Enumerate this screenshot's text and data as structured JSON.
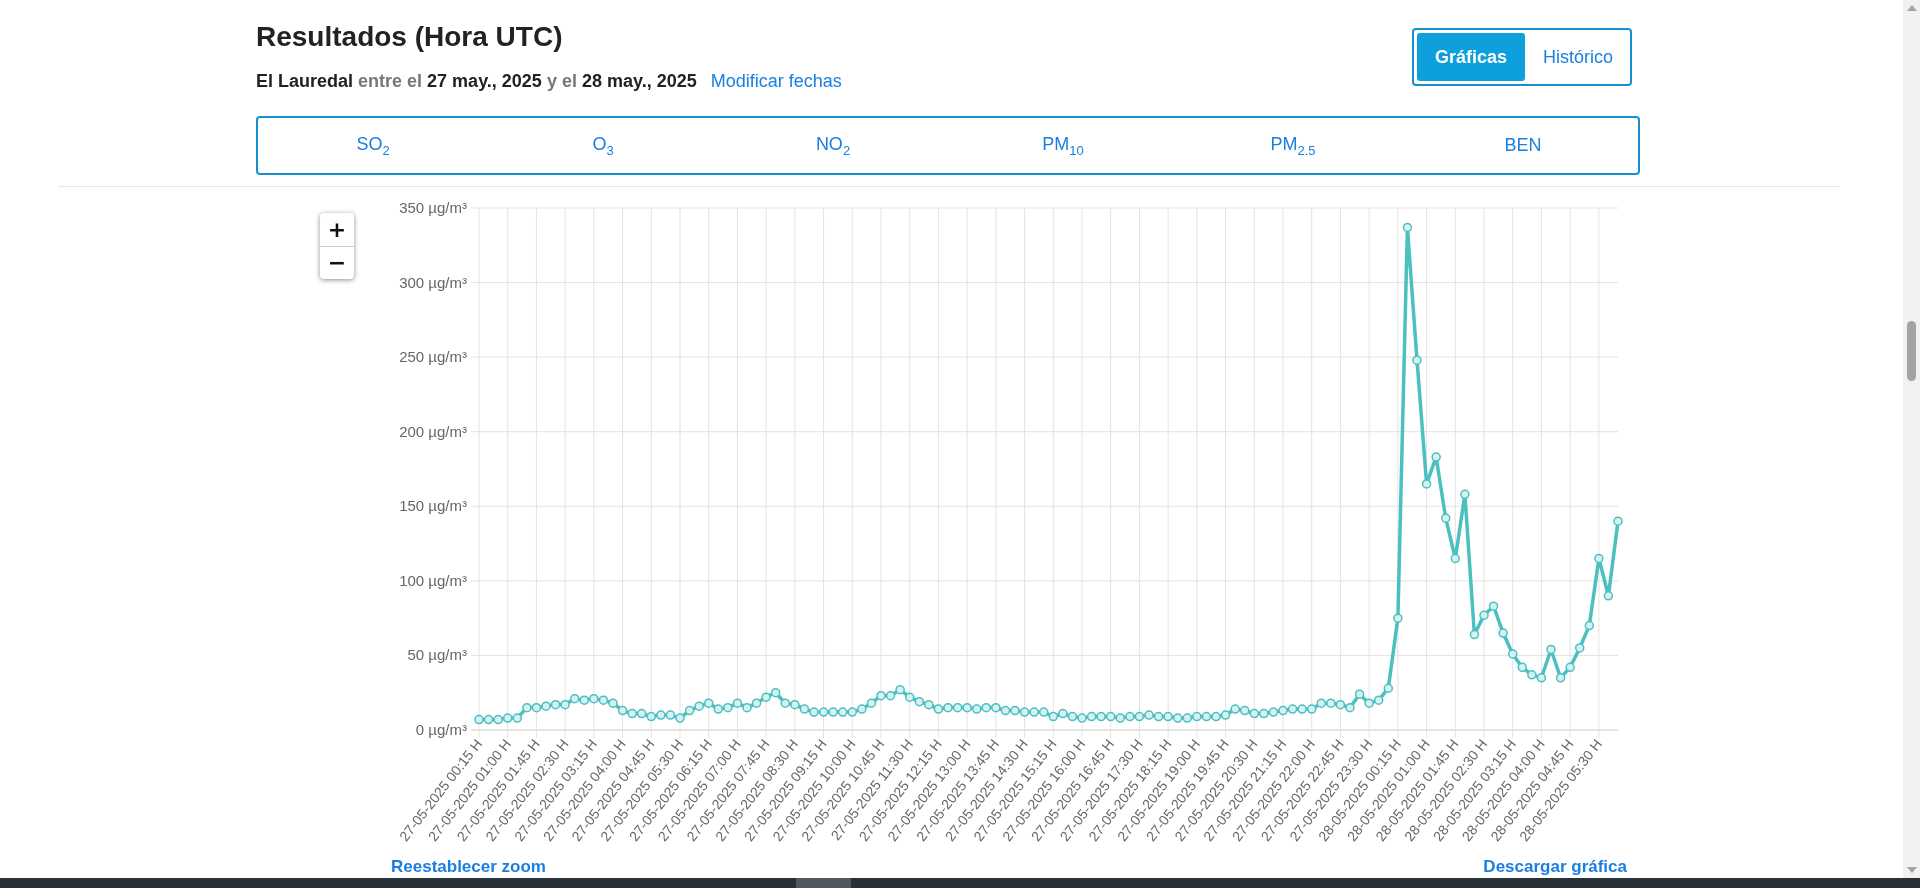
{
  "header": {
    "title": "Resultados (Hora UTC)",
    "subtitle": {
      "station": "El Lauredal",
      "from_word": "entre el",
      "from_date": "27 may., 2025",
      "to_word": "y el",
      "to_date": "28 may., 2025"
    },
    "modify_link": "Modificar fechas",
    "view_toggle": [
      {
        "label": "Gráficas",
        "selected": true
      },
      {
        "label": "Histórico",
        "selected": false
      }
    ],
    "pollutant_tabs": [
      {
        "label": "SO$_{2}$",
        "selected": false
      },
      {
        "label": "O$_{3}$",
        "selected": false
      },
      {
        "label": "NO$_{2}$",
        "selected": false
      },
      {
        "label": "PM$_{10}$",
        "selected": false
      },
      {
        "label": "PM$_{2.5}$",
        "selected": false
      },
      {
        "label": "BEN",
        "selected": false
      }
    ]
  },
  "chart": {
    "zoom_controls": [
      "+",
      "−"
    ],
    "chart_data": {
      "type": "line",
      "grid": true,
      "ylim": [
        0,
        350
      ],
      "yticks": [
        {
          "value": 0,
          "label": "0 µg/m³"
        },
        {
          "value": 50,
          "label": "50 µg/m³"
        },
        {
          "value": 100,
          "label": "100 µg/m³"
        },
        {
          "value": 150,
          "label": "150 µg/m³"
        },
        {
          "value": 200,
          "label": "200 µg/m³"
        },
        {
          "value": 250,
          "label": "250 µg/m³"
        },
        {
          "value": 300,
          "label": "300 µg/m³"
        },
        {
          "value": 350,
          "label": "350 µg/m³"
        }
      ],
      "categories": [
        "27-05-2025 00:15 H",
        null,
        null,
        "27-05-2025 01:00 H",
        null,
        null,
        "27-05-2025 01:45 H",
        null,
        null,
        "27-05-2025 02:30 H",
        null,
        null,
        "27-05-2025 03:15 H",
        null,
        null,
        "27-05-2025 04:00 H",
        null,
        null,
        "27-05-2025 04:45 H",
        null,
        null,
        "27-05-2025 05:30 H",
        null,
        null,
        "27-05-2025 06:15 H",
        null,
        null,
        "27-05-2025 07:00 H",
        null,
        null,
        "27-05-2025 07:45 H",
        null,
        null,
        "27-05-2025 08:30 H",
        null,
        null,
        "27-05-2025 09:15 H",
        null,
        null,
        "27-05-2025 10:00 H",
        null,
        null,
        "27-05-2025 10:45 H",
        null,
        null,
        "27-05-2025 11:30 H",
        null,
        null,
        "27-05-2025 12:15 H",
        null,
        null,
        "27-05-2025 13:00 H",
        null,
        null,
        "27-05-2025 13:45 H",
        null,
        null,
        "27-05-2025 14:30 H",
        null,
        null,
        "27-05-2025 15:15 H",
        null,
        null,
        "27-05-2025 16:00 H",
        null,
        null,
        "27-05-2025 16:45 H",
        null,
        null,
        "27-05-2025 17:30 H",
        null,
        null,
        "27-05-2025 18:15 H",
        null,
        null,
        "27-05-2025 19:00 H",
        null,
        null,
        "27-05-2025 19:45 H",
        null,
        null,
        "27-05-2025 20:30 H",
        null,
        null,
        "27-05-2025 21:15 H",
        null,
        null,
        "27-05-2025 22:00 H",
        null,
        null,
        "27-05-2025 22:45 H",
        null,
        null,
        "27-05-2025 23:30 H",
        null,
        null,
        "28-05-2025 00:15 H",
        null,
        null,
        "28-05-2025 01:00 H",
        null,
        null,
        "28-05-2025 01:45 H",
        null,
        null,
        "28-05-2025 02:30 H",
        null,
        null,
        "28-05-2025 03:15 H",
        null,
        null,
        "28-05-2025 04:00 H",
        null,
        null,
        "28-05-2025 04:45 H",
        null,
        null,
        "28-05-2025 05:30 H",
        null,
        null
      ],
      "series": [
        {
          "color": "#4bc0c0",
          "marker": "circle",
          "values": [
            7,
            7,
            7,
            8,
            8,
            15,
            15,
            16,
            17,
            17,
            21,
            20,
            21,
            20,
            18,
            13,
            11,
            11,
            9,
            10,
            10,
            8,
            13,
            16,
            18,
            14,
            15,
            18,
            15,
            18,
            22,
            25,
            18,
            17,
            14,
            12,
            12,
            12,
            12,
            12,
            14,
            18,
            23,
            23,
            27,
            22,
            19,
            17,
            14,
            15,
            15,
            15,
            14,
            15,
            15,
            13,
            13,
            12,
            12,
            12,
            9,
            11,
            9,
            8,
            9,
            9,
            9,
            8,
            9,
            9,
            10,
            9,
            9,
            8,
            8,
            9,
            9,
            9,
            10,
            14,
            13,
            11,
            11,
            12,
            13,
            14,
            14,
            14,
            18,
            18,
            17,
            15,
            24,
            18,
            20,
            28,
            75,
            337,
            248,
            165,
            183,
            142,
            115,
            158,
            64,
            77,
            83,
            65,
            51,
            42,
            37,
            35,
            54,
            35,
            42,
            55,
            70,
            115,
            90,
            140
          ]
        }
      ]
    },
    "reset_zoom_link": "Reestablecer zoom",
    "download_link": "Descargar gráfica"
  }
}
